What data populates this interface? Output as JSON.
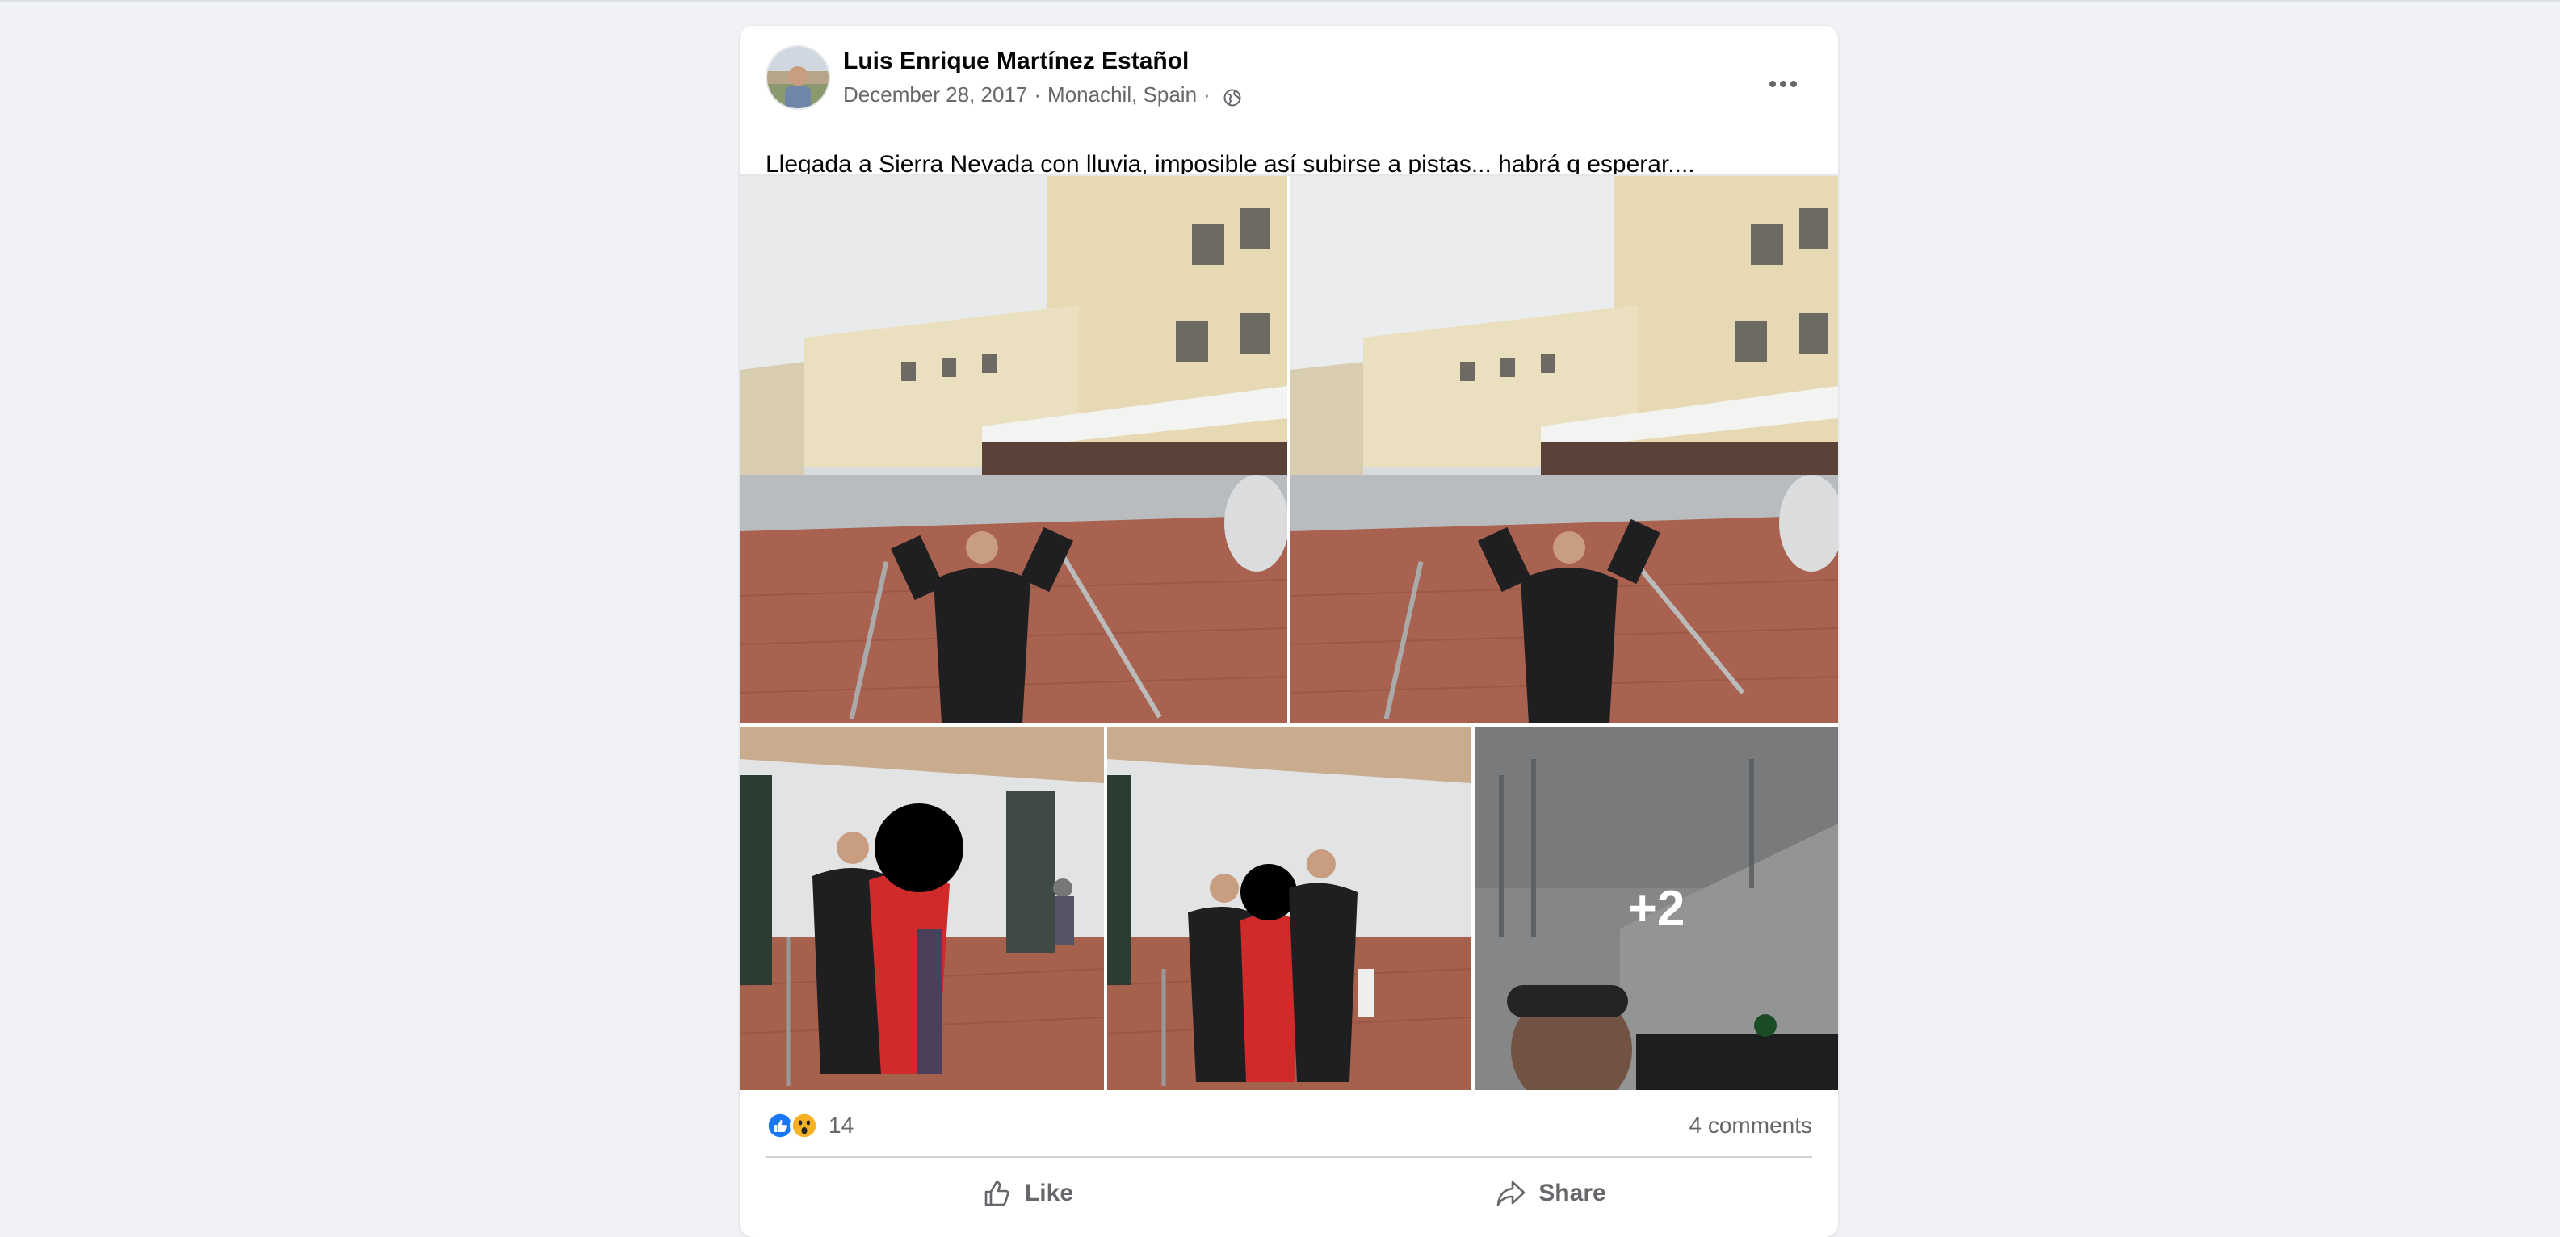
{
  "post": {
    "author": "Luis Enrique Martínez Estañol",
    "date": "December 28, 2017",
    "location": "Monachil, Spain",
    "meta_separator": "·",
    "privacy_icon": "globe-icon",
    "text": "Llegada a Sierra Nevada con lluvia, imposible así subirse a pistas... habrá q esperar...."
  },
  "photos": {
    "count_visible": 5,
    "more_label": "+2"
  },
  "engagement": {
    "reaction_icons": [
      "like-icon",
      "wow-icon"
    ],
    "reaction_count": "14",
    "comments_label": "4 comments"
  },
  "actions": {
    "like_label": "Like",
    "share_label": "Share"
  },
  "colors": {
    "page_bg": "#f0f2f5",
    "card_bg": "#ffffff",
    "secondary_text": "#65676b",
    "like_blue": "#1877f2",
    "wow_yellow": "#f7b125"
  }
}
